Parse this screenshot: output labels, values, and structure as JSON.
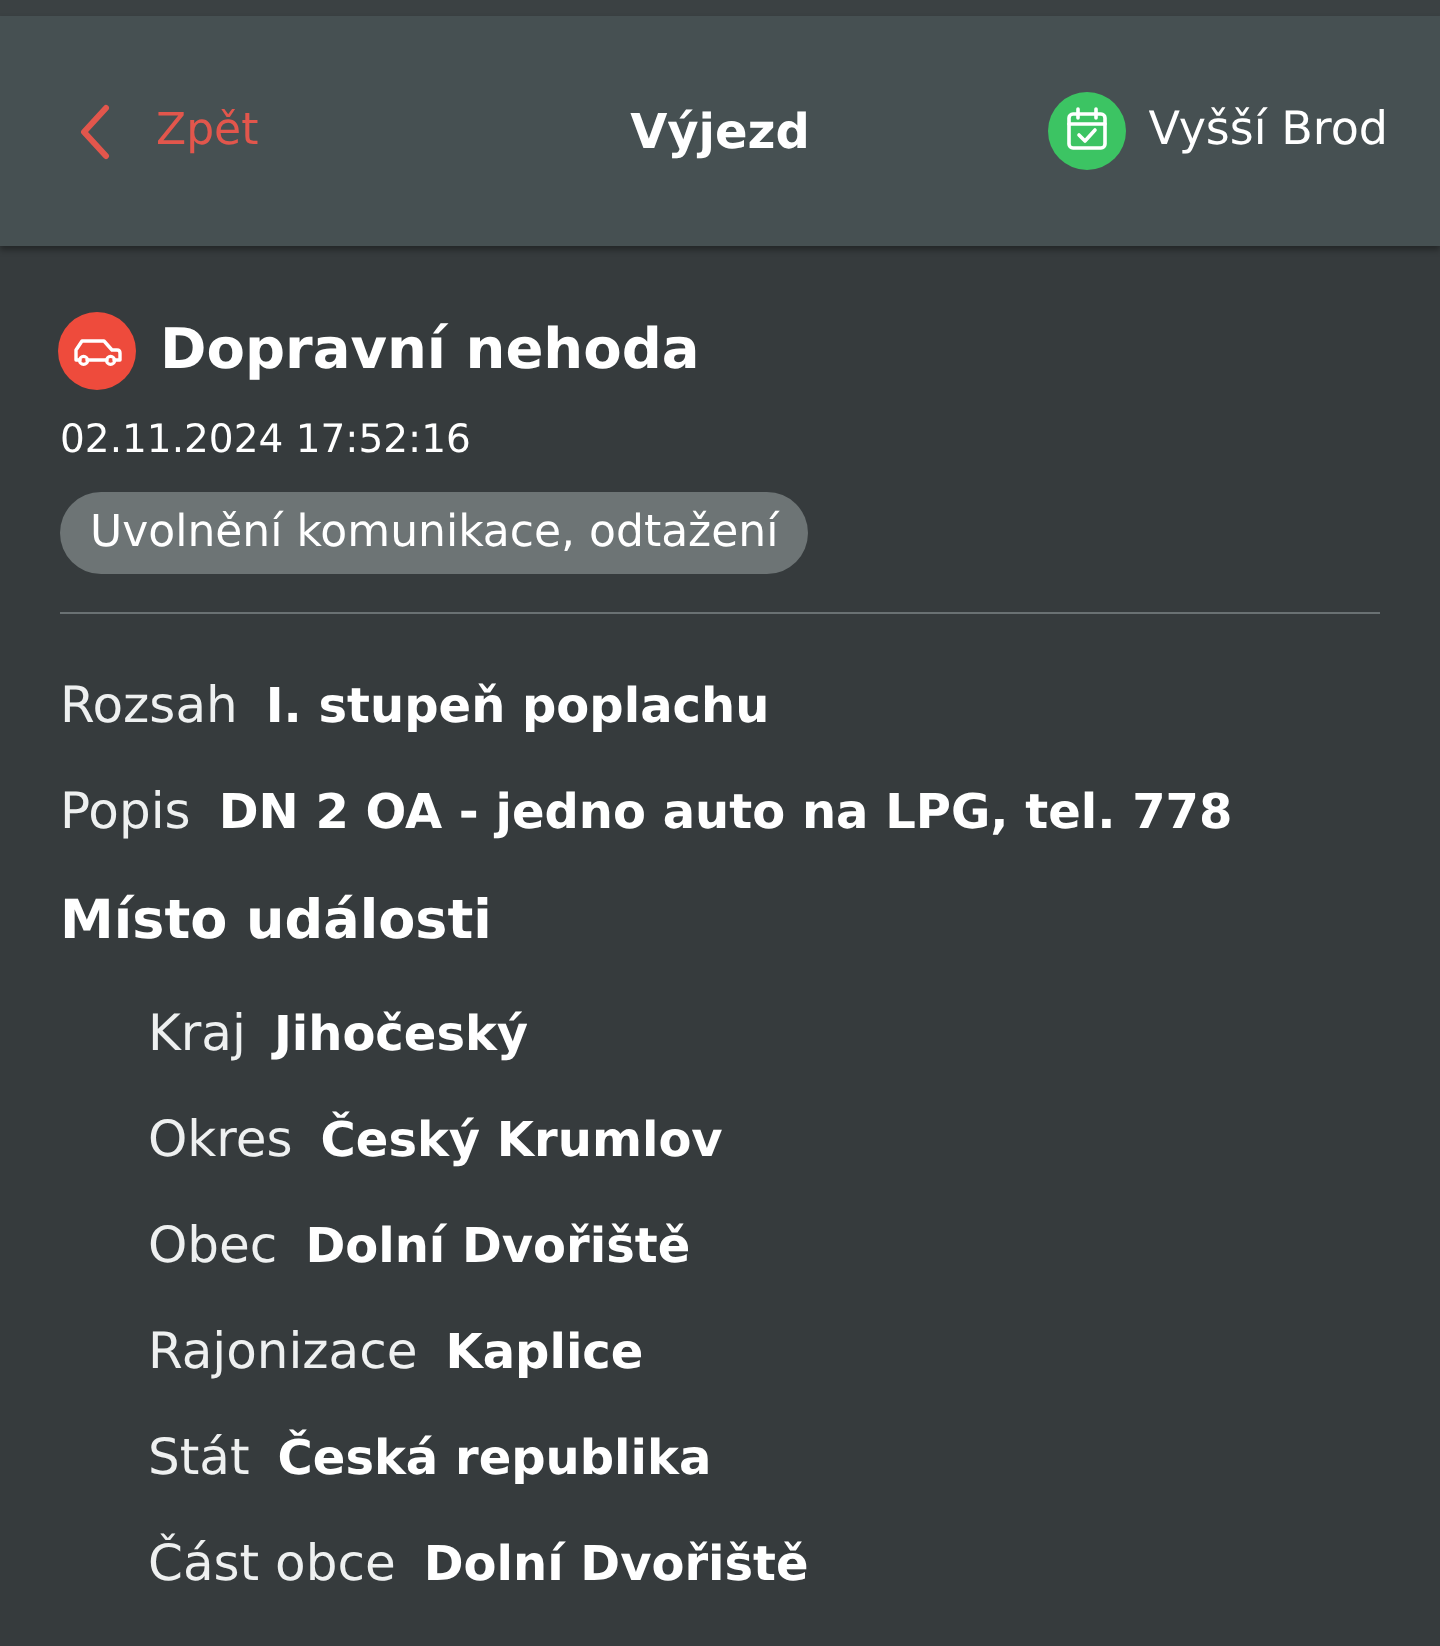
{
  "header": {
    "back": {
      "label": "Zpět"
    },
    "title": "Výjezd",
    "unit": {
      "label": "Vyšší Brod"
    }
  },
  "event": {
    "type": "Dopravní nehoda",
    "datetime": "02.11.2024 17:52:16",
    "tags": [
      "Uvolnění komunikace, odtažení"
    ]
  },
  "details": [
    {
      "label": "Rozsah",
      "value": "I. stupeň poplachu"
    },
    {
      "label": "Popis",
      "value": "DN 2 OA - jedno auto na LPG, tel. 778"
    }
  ],
  "location": {
    "title": "Místo události",
    "fields": [
      {
        "label": "Kraj",
        "value": "Jihočeský"
      },
      {
        "label": "Okres",
        "value": "Český Krumlov"
      },
      {
        "label": "Obec",
        "value": "Dolní Dvořiště"
      },
      {
        "label": "Rajonizace",
        "value": "Kaplice"
      },
      {
        "label": "Stát",
        "value": "Česká republika"
      },
      {
        "label": "Část obce",
        "value": "Dolní Dvořiště"
      }
    ]
  }
}
